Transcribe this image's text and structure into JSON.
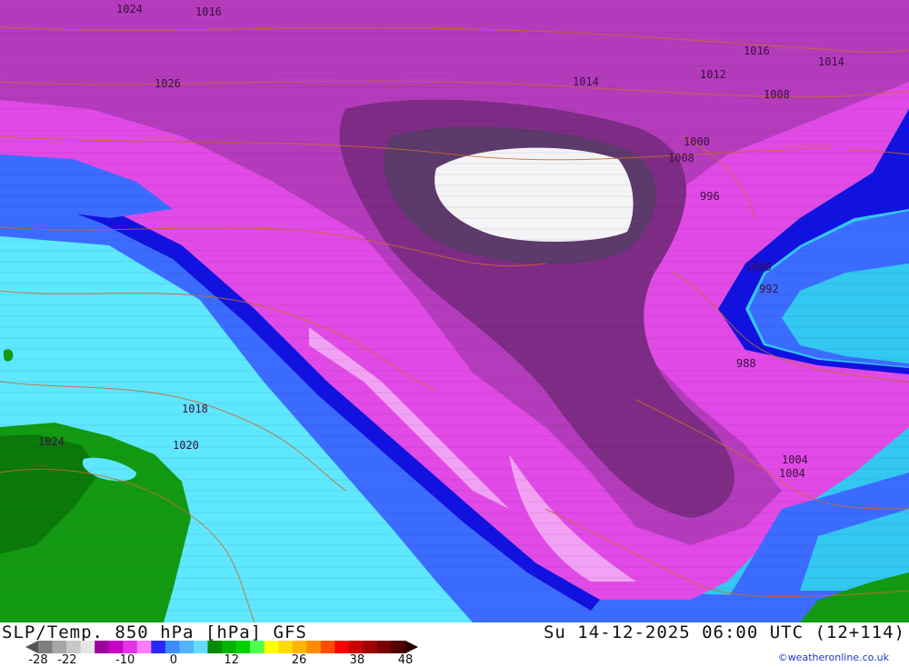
{
  "title": {
    "left": "SLP/Temp. 850 hPa [hPa] GFS",
    "right": "Su 14-12-2025 06:00 UTC (12+114)"
  },
  "credit": "©weatheronline.co.uk",
  "legend": {
    "ticks": [
      "-28",
      "-22",
      "-10",
      "0",
      "12",
      "26",
      "38",
      "48"
    ],
    "colors": [
      "#7f7f7f",
      "#a6a6a6",
      "#c8c8c8",
      "#e6e6e6",
      "#a000a0",
      "#c800c8",
      "#e632e6",
      "#ff7cff",
      "#2828ff",
      "#3c8cff",
      "#50b4ff",
      "#64dcff",
      "#008c00",
      "#00b400",
      "#00d200",
      "#50ff50",
      "#ffff00",
      "#ffdc00",
      "#ffb400",
      "#ff8c00",
      "#ff5000",
      "#ff0000",
      "#c80000",
      "#a00000",
      "#780000",
      "#500000"
    ]
  },
  "map": {
    "pressure_labels": [
      "1026",
      "1024",
      "1024",
      "1020",
      "1018",
      "1016",
      "1016",
      "1014",
      "1014",
      "1012",
      "1008",
      "1008",
      "1004",
      "1004",
      "1000",
      "1000",
      "996",
      "992",
      "988"
    ],
    "colors": {
      "cold_core": "#5c3a6b",
      "purple_deep": "#7e2c86",
      "purple": "#b43cbc",
      "magenta": "#e14ae6",
      "pink_light": "#f2a2f4",
      "blue_dark": "#1212e0",
      "blue": "#3b6cff",
      "cyan": "#33c8f2",
      "cyan_light": "#5ee8ff",
      "green_dark": "#0b7a0b",
      "green": "#139a13",
      "white_core": "#f4f4f6",
      "isobar": "#cc6a2a"
    }
  }
}
